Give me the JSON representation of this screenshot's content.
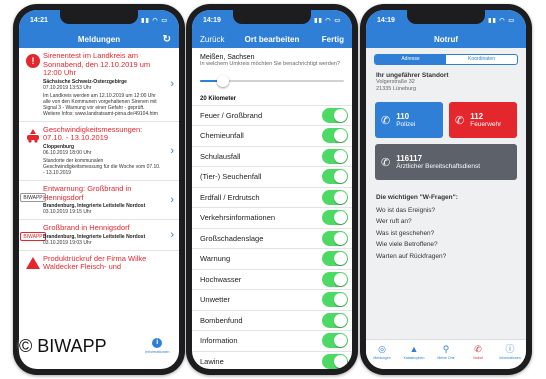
{
  "colors": {
    "primary": "#2f7fd6",
    "alert_red": "#e4262d",
    "toggle_green": "#4cd964",
    "dark_button": "#5d6169"
  },
  "watermark": "© BIWAPP",
  "phone1": {
    "status": {
      "time": "14:21"
    },
    "nav_title": "Meldungen",
    "refresh_icon": "refresh-icon",
    "items": [
      {
        "title": "Sirenentest im Landkreis am Sonnabend, den 12.10.2019 um 12:00 Uhr",
        "source": "Sächsische Schweiz-Osterzgebirge",
        "date": "07.10.2019 13:53 Uhr",
        "text": "Im Landkreis werden am 12.10.2019 um 12:00 Uhr alle von den Kommunen vorgehaltenen Sirenen mit Signal 3 - Warnung vor einer Gefahr - geprüft. Weitere Infos: www.landratsamt-pirna.de/49104.htm"
      },
      {
        "title": "Geschwindigkeitsmessungen: 07.10. - 13.10.2019",
        "source": "Cloppenburg",
        "date": "06.10.2019 18:00 Uhr",
        "text": "Standorte der kommunalen Geschwindigkeitsmessung für die Woche vom 07.10. - 13.10.2019"
      },
      {
        "title": "Entwarnung: Großbrand in Hennigsdorf",
        "source": "Brandenburg, Integrierte Leitstelle Nordost",
        "date": "03.10.2019 19:15 Uhr",
        "text": ""
      },
      {
        "title": "Großbrand in Hennigsdorf",
        "source": "Brandenburg, Integrierte Leitstelle Nordost",
        "date": "03.10.2019 19:03 Uhr",
        "text": ""
      },
      {
        "title": "Produktrückruf der Firma Wilke Waldecker Fleisch- und",
        "source": "",
        "date": "",
        "text": ""
      }
    ],
    "badge_text": "BIWAPP",
    "info_tab_label": "Informationen"
  },
  "phone2": {
    "status": {
      "time": "14:19"
    },
    "nav_back": "Zurück",
    "nav_title": "Ort bearbeiten",
    "nav_done": "Fertig",
    "location": "Meißen, Sachsen",
    "question": "In welchem Umkreis möchten Sie benachrichtigt werden?",
    "radius_fraction": 0.13,
    "radius_label": "20 Kilometer",
    "categories": [
      "Feuer / Großbrand",
      "Chemieunfall",
      "Schulausfall",
      "(Tier-) Seuchenfall",
      "Erdfall / Erdrutsch",
      "Verkehrsinformationen",
      "Großschadenslage",
      "Warnung",
      "Hochwasser",
      "Unwetter",
      "Bombenfund",
      "Information",
      "Lawine"
    ]
  },
  "phone3": {
    "status": {
      "time": "14:19"
    },
    "nav_title": "Notruf",
    "segments": [
      "Adresse",
      "Koordinaten"
    ],
    "address_heading": "Ihr ungefährer Standort",
    "address_line1": "Volgerstraße 32",
    "address_line2": "21335 Lüneburg",
    "police_number": "110",
    "police_label": "Polizei",
    "fire_number": "112",
    "fire_label": "Feuerwehr",
    "service_number": "116117",
    "service_label": "Ärztlicher Bereitschaftsdienst",
    "questions_heading": "Die wichtigen \"W-Fragen\":",
    "questions": [
      "Wo ist das Ereignis?",
      "Wer ruft an?",
      "Was ist geschehen?",
      "Wie viele Betroffene?",
      "Warten auf Rückfragen?"
    ],
    "tabs": [
      {
        "label": "Meldungen",
        "icon": "lifebuoy-icon"
      },
      {
        "label": "Katastrophen",
        "icon": "warning-icon"
      },
      {
        "label": "Meine Orte",
        "icon": "location-pin-icon"
      },
      {
        "label": "Notruf",
        "icon": "phone-icon"
      },
      {
        "label": "Informationen",
        "icon": "info-icon"
      }
    ]
  }
}
